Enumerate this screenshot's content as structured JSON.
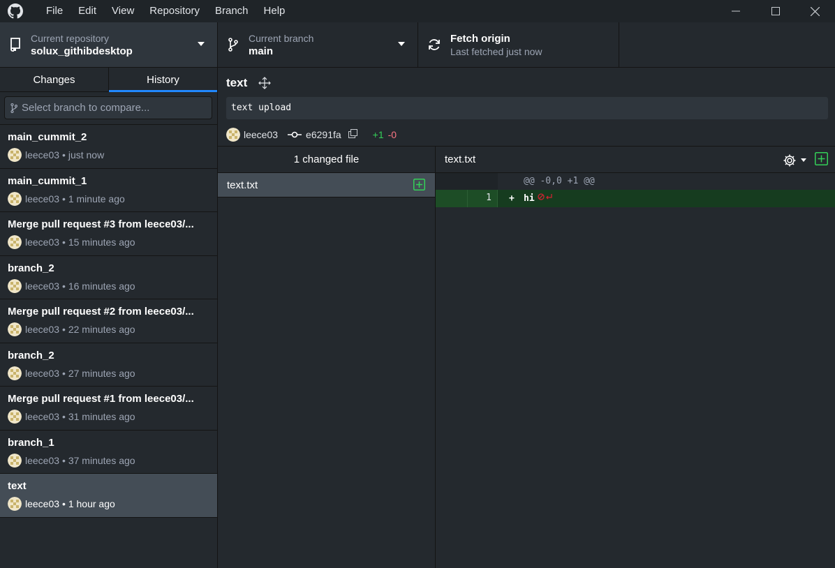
{
  "menu": [
    "File",
    "Edit",
    "View",
    "Repository",
    "Branch",
    "Help"
  ],
  "toolbar": {
    "repo_label": "Current repository",
    "repo_value": "solux_githibdesktop",
    "branch_label": "Current branch",
    "branch_value": "main",
    "fetch_label": "Fetch origin",
    "fetch_sub": "Last fetched just now"
  },
  "sidebar": {
    "tabs": [
      "Changes",
      "History"
    ],
    "active_tab": "History",
    "compare_placeholder": "Select branch to compare...",
    "commits": [
      {
        "title": "main_cummit_2",
        "author": "leece03",
        "time": "• just now"
      },
      {
        "title": "main_cummit_1",
        "author": "leece03",
        "time": "• 1 minute ago"
      },
      {
        "title": "Merge pull request #3 from leece03/...",
        "author": "leece03",
        "time": "• 15 minutes ago"
      },
      {
        "title": "branch_2",
        "author": "leece03",
        "time": "• 16 minutes ago"
      },
      {
        "title": "Merge pull request #2 from leece03/...",
        "author": "leece03",
        "time": "• 22 minutes ago"
      },
      {
        "title": "branch_2",
        "author": "leece03",
        "time": "• 27 minutes ago"
      },
      {
        "title": "Merge pull request #1 from leece03/...",
        "author": "leece03",
        "time": "• 31 minutes ago"
      },
      {
        "title": "branch_1",
        "author": "leece03",
        "time": "• 37 minutes ago"
      },
      {
        "title": "text",
        "author": "leece03",
        "time": "• 1 hour ago"
      }
    ]
  },
  "commit": {
    "title": "text",
    "description": "text upload",
    "author": "leece03",
    "sha": "e6291fa",
    "additions": "+1",
    "deletions": "-0"
  },
  "files": {
    "header": "1 changed file",
    "items": [
      {
        "name": "text.txt"
      }
    ]
  },
  "diff": {
    "file": "text.txt",
    "hunk": "@@ -0,0 +1 @@",
    "line_number": "1",
    "line_marker": "+",
    "line_text": "hi"
  },
  "colors": {
    "accent": "#2188ff",
    "added": "#34d058",
    "deleted": "#f97583"
  }
}
